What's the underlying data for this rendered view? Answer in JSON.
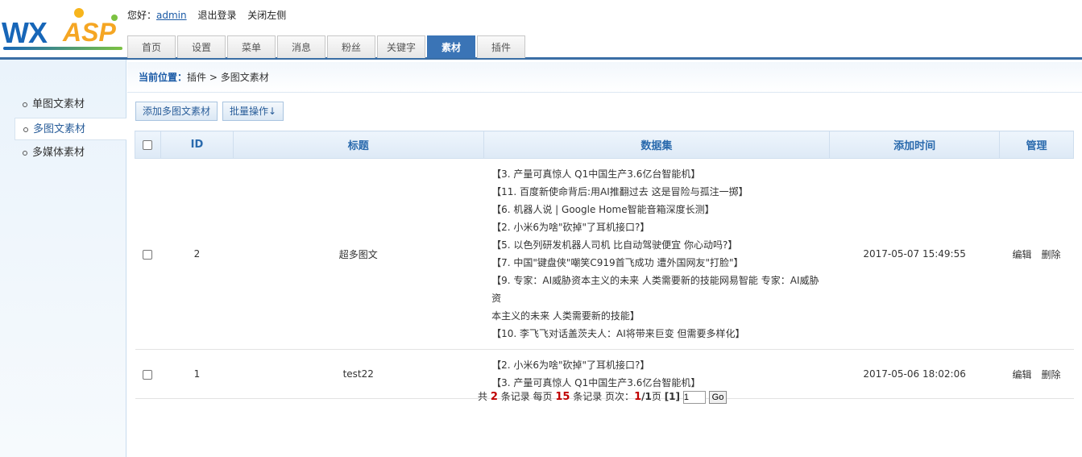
{
  "header": {
    "logo": {
      "wx": "WX",
      "asp": "ASP"
    },
    "greeting": "您好：",
    "user": "admin",
    "logout": "退出登录",
    "close_left": "关闭左侧"
  },
  "tabs": [
    {
      "label": "首页"
    },
    {
      "label": "设置"
    },
    {
      "label": "菜单"
    },
    {
      "label": "消息"
    },
    {
      "label": "粉丝"
    },
    {
      "label": "关键字"
    },
    {
      "label": "素材",
      "active": true
    },
    {
      "label": "插件"
    }
  ],
  "sidebar": {
    "items": [
      {
        "label": "单图文素材"
      },
      {
        "label": "多图文素材",
        "active": true
      },
      {
        "label": "多媒体素材"
      }
    ]
  },
  "breadcrumb": {
    "label": "当前位置：",
    "path": "插件 > 多图文素材"
  },
  "toolbar": {
    "add_label": "添加多图文素材",
    "batch_label": "批量操作↓"
  },
  "table": {
    "columns": [
      "ID",
      "标题",
      "数据集",
      "添加时间",
      "管理"
    ],
    "rows": [
      {
        "id": "2",
        "title": "超多图文",
        "items": [
          "【3. 产量可真惊人 Q1中国生产3.6亿台智能机】",
          "【11. 百度新使命背后:用AI推翻过去 这是冒险与孤注一掷】",
          "【6. 机器人说 | Google Home智能音箱深度长测】",
          "【2. 小米6为啥\"砍掉\"了耳机接口?】",
          "【5. 以色列研发机器人司机 比自动驾驶便宜 你心动吗?】",
          "【7. 中国\"键盘侠\"嘲笑C919首飞成功 遭外国网友\"打脸\"】",
          "【9. 专家：AI威胁资本主义的未来 人类需要新的技能网易智能 专家：AI威胁资",
          "本主义的未来 人类需要新的技能】",
          "【10. 李飞飞对话盖茨夫人：AI将带来巨变 但需要多样化】"
        ],
        "time": "2017-05-07 15:49:55",
        "edit": "编辑",
        "delete": "删除"
      },
      {
        "id": "1",
        "title": "test22",
        "items": [
          "【2. 小米6为啥\"砍掉\"了耳机接口?】",
          "【3. 产量可真惊人 Q1中国生产3.6亿台智能机】"
        ],
        "time": "2017-05-06 18:02:06",
        "edit": "编辑",
        "delete": "删除"
      }
    ]
  },
  "pager": {
    "total_prefix": "共 ",
    "total": "2",
    "total_suffix": " 条记录 每页 ",
    "per_page": "15",
    "per_page_suffix": " 条记录 页次：",
    "current": "1",
    "slash": "/",
    "pages": "1",
    "pages_suffix": "页 ",
    "page_link": "[1]",
    "page_input": "1",
    "go_label": "Go"
  },
  "colors": {
    "accent": "#3a74b6",
    "header_text": "#2a6aad",
    "highlight": "#c00000"
  }
}
